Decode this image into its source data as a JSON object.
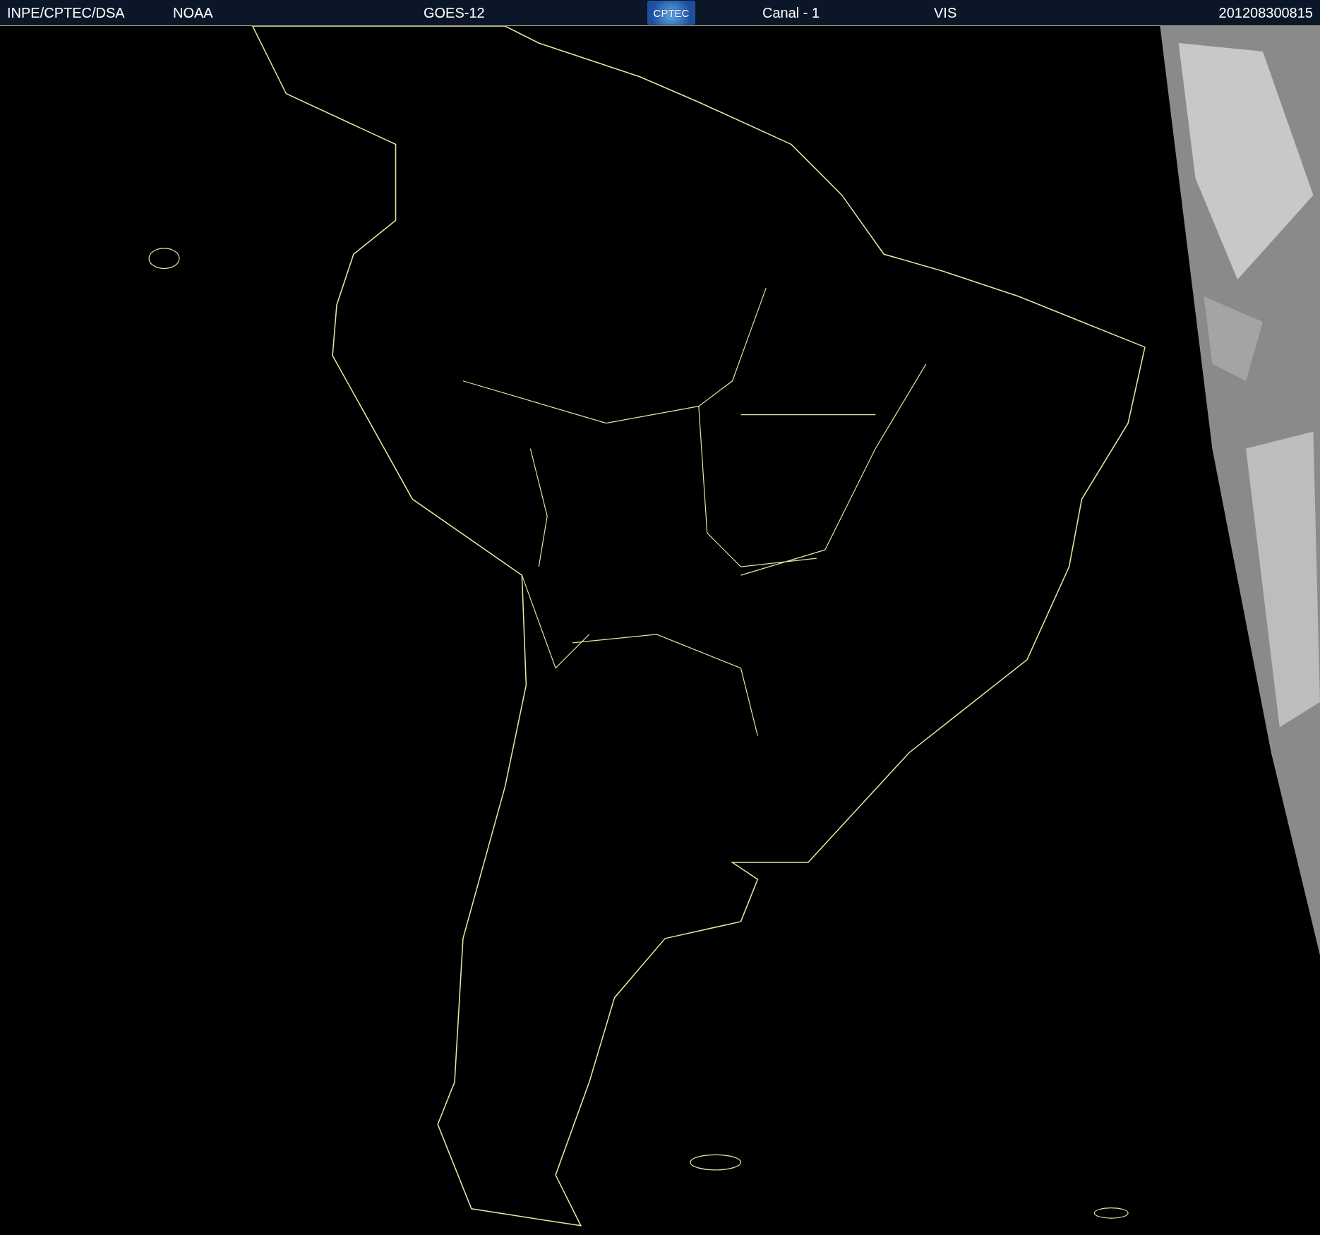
{
  "header": {
    "items": [
      {
        "kind": "text",
        "label": "INPE/CPTEC/DSA"
      },
      {
        "kind": "text",
        "label": "NOAA"
      },
      {
        "kind": "text",
        "label": "GOES-12"
      },
      {
        "kind": "logo",
        "label": "CPTEC"
      },
      {
        "kind": "text",
        "label": "Canal - 1"
      },
      {
        "kind": "text",
        "label": "VIS"
      },
      {
        "kind": "text",
        "label": "201208300815"
      }
    ]
  }
}
